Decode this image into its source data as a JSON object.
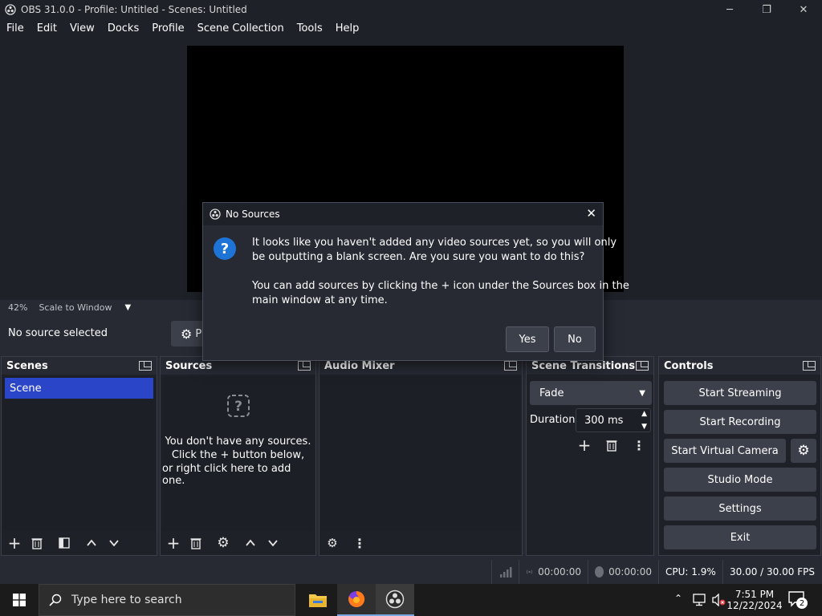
{
  "window": {
    "title": "OBS 31.0.0 - Profile: Untitled - Scenes: Untitled",
    "minimize": "─",
    "maximize": "❐",
    "close": "✕"
  },
  "menu": [
    "File",
    "Edit",
    "View",
    "Docks",
    "Profile",
    "Scene Collection",
    "Tools",
    "Help"
  ],
  "preview": {
    "zoom": "42%",
    "scale_mode": "Scale to Window"
  },
  "source_toolbar": {
    "status": "No source selected",
    "properties_label": "P"
  },
  "docks": {
    "scenes": {
      "title": "Scenes",
      "items": [
        "Scene"
      ],
      "selected": "Scene"
    },
    "sources": {
      "title": "Sources",
      "empty_line1": "You don't have any sources.",
      "empty_line2": "Click the + button below,",
      "empty_line3": "or right click here to add one."
    },
    "audio_mixer": {
      "title": "Audio Mixer"
    },
    "transitions": {
      "title": "Scene Transitions",
      "selected": "Fade",
      "duration_label": "Duration",
      "duration_value": "300 ms"
    },
    "controls": {
      "title": "Controls",
      "start_streaming": "Start Streaming",
      "start_recording": "Start Recording",
      "start_virtual_camera": "Start Virtual Camera",
      "studio_mode": "Studio Mode",
      "settings": "Settings",
      "exit": "Exit"
    }
  },
  "status": {
    "stream_time": "00:00:00",
    "record_time": "00:00:00",
    "cpu": "CPU: 1.9%",
    "fps": "30.00 / 30.00 FPS"
  },
  "dialog": {
    "title": "No Sources",
    "line1": "It looks like you haven't added any video sources yet, so you will only",
    "line2": "be outputting a blank screen. Are you sure you want to do this?",
    "line3": "You can add sources by clicking the + icon under the Sources box in the",
    "line4": "main window at any time.",
    "yes": "Yes",
    "no": "No"
  },
  "taskbar": {
    "search_placeholder": "Type here to search",
    "time": "7:51 PM",
    "date": "12/22/2024",
    "notification_count": "2"
  },
  "colors": {
    "accent_selected": "#2b45c9",
    "button": "#3c404b",
    "dock_bg": "#1f2129"
  }
}
